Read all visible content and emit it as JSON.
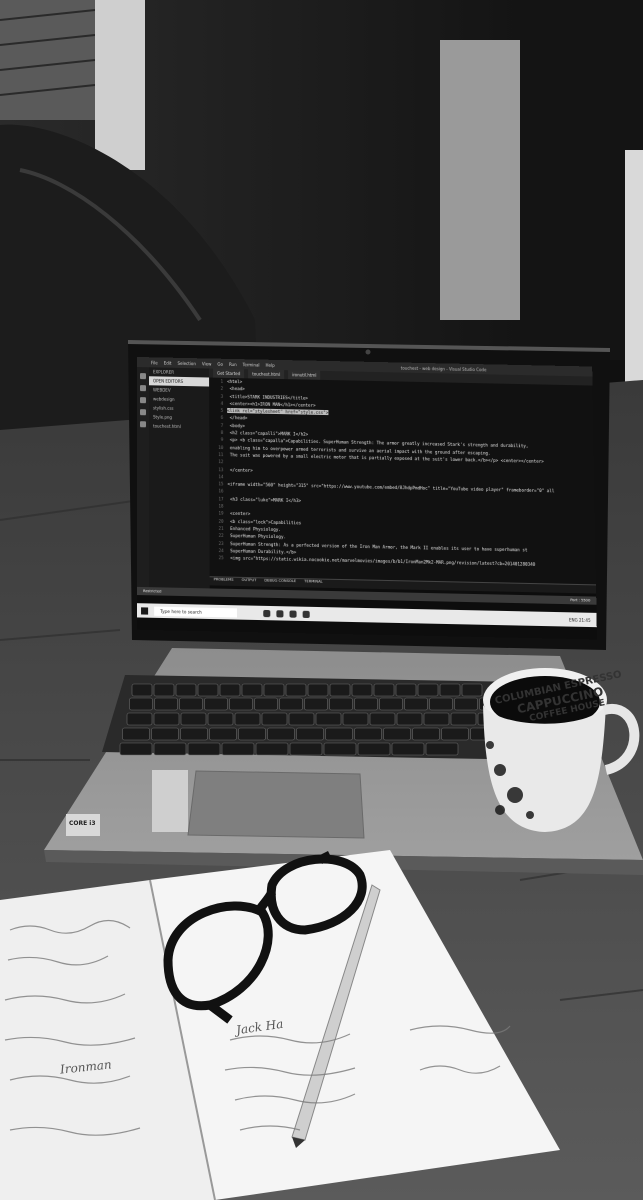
{
  "photo": {
    "description_free": true,
    "screen": {
      "menu": [
        "File",
        "Edit",
        "Selection",
        "View",
        "Go",
        "Run",
        "Terminal",
        "Help"
      ],
      "window_title": "touchest - web design - Visual Studio Code",
      "tabs": [
        "Get Started",
        "touchest.html",
        "ironutil.html"
      ],
      "explorer": [
        "EXPLORER",
        "OPEN EDITORS",
        "WEBDEV",
        "webdesign",
        "stylish.css",
        "Style.png",
        "touchest.html"
      ],
      "code": [
        {
          "n": "1",
          "t": "<html>",
          "hl": false
        },
        {
          "n": "2",
          "t": "  <head>",
          "hl": false
        },
        {
          "n": "3",
          "t": "    <title>STARK INDUSTRIES</title>",
          "hl": false
        },
        {
          "n": "4",
          "t": "    <center><h1>IRON MAN</h1></center>",
          "hl": false
        },
        {
          "n": "5",
          "t": "<link rel=\"stylesheet\" href=\"style.css\">",
          "hl": true
        },
        {
          "n": "6",
          "t": "  </head>",
          "hl": false
        },
        {
          "n": "7",
          "t": "  <body>",
          "hl": false
        },
        {
          "n": "8",
          "t": "    <h2 class=\"capalli\">MARK I</h2>",
          "hl": false
        },
        {
          "n": "9",
          "t": "    <p> <b class=\"capalla\">Capabilities. SuperHuman Strength: The armor greatly increased Stark's strength and durability,",
          "hl": false
        },
        {
          "n": "10",
          "t": "      enabling him to overpower armed terrorists and survive an aerial impact with the ground after escaping.",
          "hl": false
        },
        {
          "n": "11",
          "t": "      The suit was powered by a small electric motor that is partially exposed at the suit's lower back.</b></p> <center></center>",
          "hl": false
        },
        {
          "n": "12",
          "t": "",
          "hl": false
        },
        {
          "n": "13",
          "t": "    </center>",
          "hl": false
        },
        {
          "n": "14",
          "t": "",
          "hl": false
        },
        {
          "n": "15",
          "t": "<iframe width=\"560\" height=\"315\" src=\"https://www.youtube.com/embed/8JhdpPmdHoc\" title=\"YouTube video player\" frameborder=\"0\" all",
          "hl": false
        },
        {
          "n": "16",
          "t": "",
          "hl": false
        },
        {
          "n": "17",
          "t": "    <h3 class=\"luke\">MARK I</h3>",
          "hl": false
        },
        {
          "n": "18",
          "t": "",
          "hl": false
        },
        {
          "n": "19",
          "t": "    <center>",
          "hl": false
        },
        {
          "n": "20",
          "t": "      <b class=\"lock\">Capabilities",
          "hl": false
        },
        {
          "n": "21",
          "t": "        Enhanced Physiology.",
          "hl": false
        },
        {
          "n": "22",
          "t": "        SuperHuman Physiology.",
          "hl": false
        },
        {
          "n": "23",
          "t": "        SuperHuman Strength: As a perfected version of the Iron Man Armor, the Mark II enables its user to have superhuman st",
          "hl": false
        },
        {
          "n": "24",
          "t": "        SuperHuman Durability.</b>",
          "hl": false
        },
        {
          "n": "25",
          "t": "      <img src=\"https://static.wikia.nocookie.net/marvelmovies/images/b/b1/IronMan2Mk2-MAR.png/revision/latest?cb=201401280340",
          "hl": false
        }
      ],
      "panel_tabs": [
        "PROBLEMS",
        "OUTPUT",
        "DEBUG CONSOLE",
        "TERMINAL"
      ],
      "status_left": "Restricted",
      "status_right": "Port : 5500",
      "taskbar_search": "Type here to search",
      "tray": "ENG  21:45"
    },
    "mug": {
      "line1": "COLUMBIAN ESPRESSO",
      "line2": "CAPPUCCINO",
      "line3": "COFFEE HOUSE"
    },
    "sticker": "CORE i3",
    "notes": [
      "Jack Ha",
      "Ironman"
    ]
  }
}
